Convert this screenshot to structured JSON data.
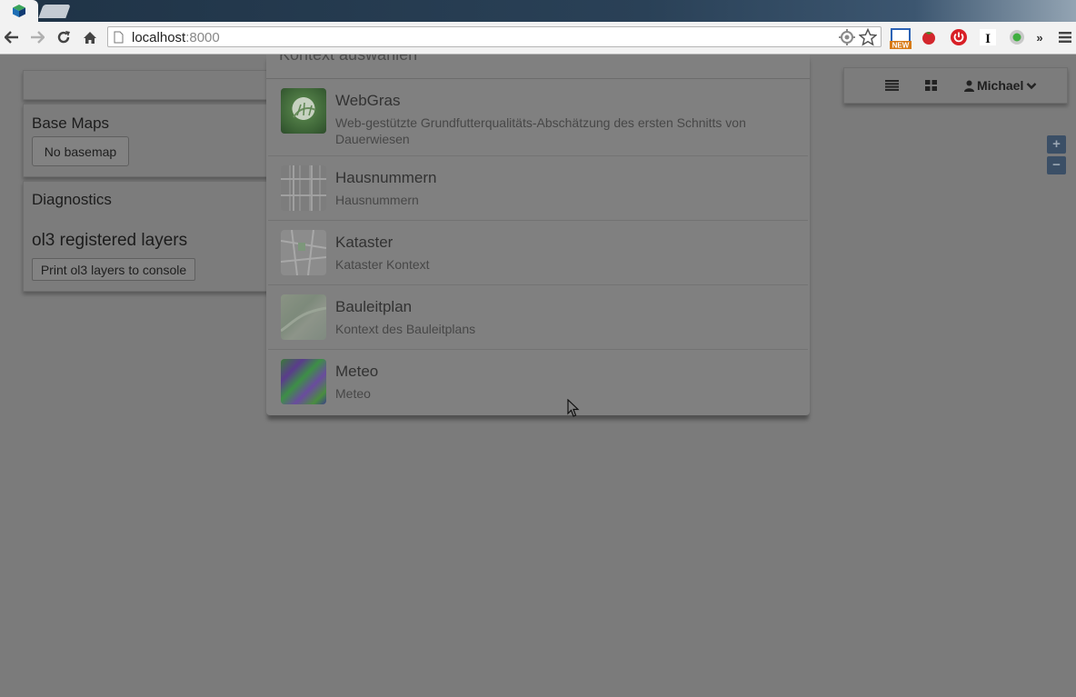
{
  "browser": {
    "url_host": "localhost",
    "url_port": ":8000",
    "extensions": [
      "screen-capture-new-icon",
      "tomato-icon",
      "power-icon",
      "i-icon",
      "green-dot-icon"
    ]
  },
  "left_panels": {
    "base_maps": {
      "title": "Base Maps",
      "button": "No basemap"
    },
    "diagnostics": {
      "title": "Diagnostics",
      "subtitle": "ol3 registered layers",
      "button": "Print ol3 layers to console"
    }
  },
  "user_menu": {
    "list_view_icon": "list-icon",
    "grid_view_icon": "grid-icon",
    "user_icon": "user-icon",
    "user_name": "Michael"
  },
  "map_controls": {
    "zoom_in": "+",
    "zoom_out": "−"
  },
  "modal": {
    "title": "Kontext auswählen",
    "items": [
      {
        "title": "WebGras",
        "description": "Web-gestützte Grundfutterqualitäts-Abschätzung des ersten Schnitts von Dauerwiesen"
      },
      {
        "title": "Hausnummern",
        "description": "Hausnummern"
      },
      {
        "title": "Kataster",
        "description": "Kataster Kontext"
      },
      {
        "title": "Bauleitplan",
        "description": "Kontext des Bauleitplans"
      },
      {
        "title": "Meteo",
        "description": "Meteo"
      }
    ]
  }
}
